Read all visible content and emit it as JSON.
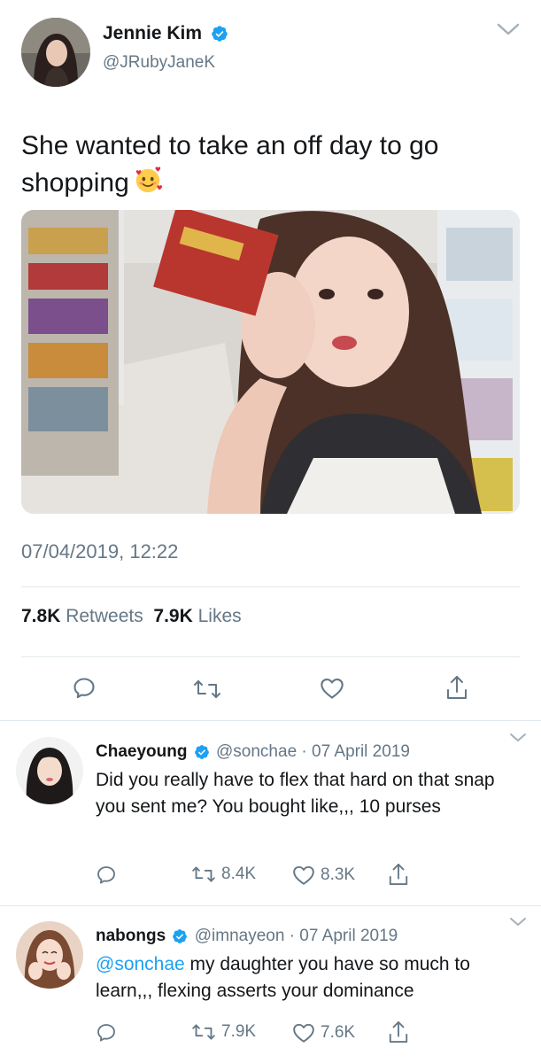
{
  "main_tweet": {
    "name": "Jennie Kim",
    "handle": "@JRubyJaneK",
    "text": "She wanted to take an off day to go shopping",
    "emoji": "smiling-face-with-hearts",
    "timestamp": "07/04/2019, 12:22",
    "retweet_count": "7.8K",
    "retweet_label": "Retweets",
    "like_count": "7.9K",
    "like_label": "Likes"
  },
  "replies": [
    {
      "name": "Chaeyoung",
      "handle": "@sonchae",
      "separator": "·",
      "date": "07 April 2019",
      "mention": "",
      "text": "Did you really have to flex that hard on that snap you sent me? You bought like,,, 10 purses",
      "retweets": "8.4K",
      "likes": "8.3K"
    },
    {
      "name": "nabongs",
      "handle": "@imnayeon",
      "separator": "·",
      "date": "07 April 2019",
      "mention": "@sonchae",
      "text": " my daughter you have so much to learn,,, flexing asserts your dominance",
      "retweets": "7.9K",
      "likes": "7.6K"
    }
  ],
  "colors": {
    "verified": "#1da1f2",
    "secondary_text": "#657786",
    "divider": "#e1e8ed",
    "mention": "#1da1f2"
  }
}
